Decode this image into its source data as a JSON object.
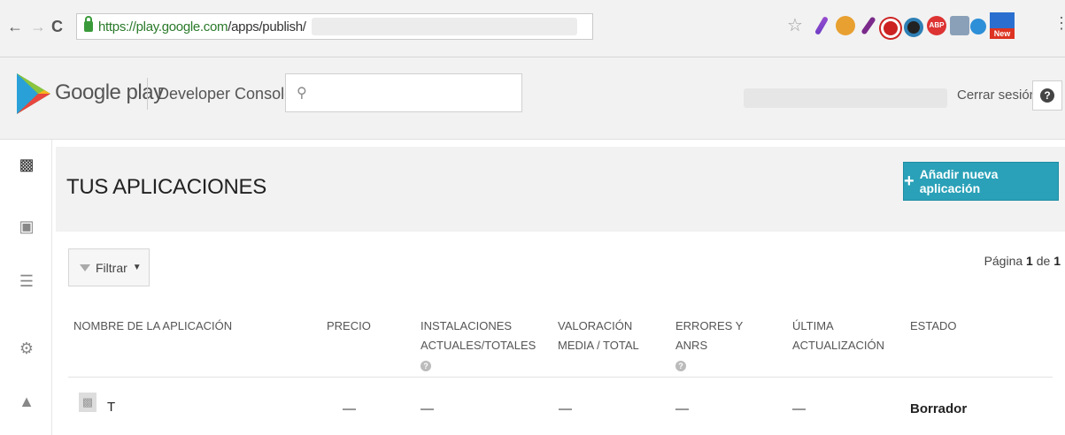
{
  "browser": {
    "url_host": "https://play.google.com",
    "url_path": "/apps/publish/",
    "new_badge": "New"
  },
  "header": {
    "brand": "Google play",
    "console": "Developer Console",
    "signout": "Cerrar sesión",
    "help_icon": "?"
  },
  "sidebar": {
    "icons": [
      "android-icon",
      "gamepad-icon",
      "database-icon",
      "gear-icon",
      "warning-icon"
    ]
  },
  "main": {
    "title": "TUS APLICACIONES",
    "add_button": "Añadir nueva aplicación",
    "filter": "Filtrar",
    "pager": {
      "prefix": "Página",
      "current": "1",
      "sep": "de",
      "total": "1"
    },
    "columns": [
      "NOMBRE DE LA APLICACIÓN",
      "PRECIO",
      "INSTALACIONES ACTUALES/TOTALES",
      "VALORACIÓN MEDIA / TOTAL",
      "ERRORES Y ANRS",
      "ÚLTIMA ACTUALIZACIÓN",
      "ESTADO"
    ],
    "rows": [
      {
        "name": "T",
        "price": "—",
        "installs": "—",
        "rating": "—",
        "errors": "—",
        "updated": "—",
        "status": "Borrador"
      }
    ]
  },
  "colors": {
    "accent": "#2aa1b8",
    "play_green": "#3bb54a"
  }
}
